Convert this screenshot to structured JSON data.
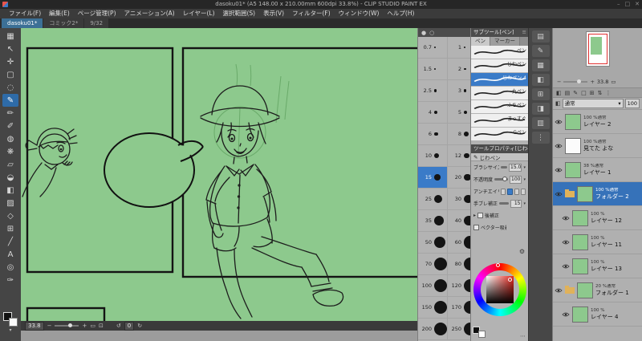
{
  "colors": {
    "accent": "#3a7bc8",
    "canvas_green": "#8dc98d",
    "selected_color": "#e8281e"
  },
  "window": {
    "title": "dasoku01* (A5 148.00 x 210.00mm 600dpi 33.8%) - CLIP STUDIO PAINT EX",
    "controls": {
      "minimize": "–",
      "maximize": "□",
      "close": "✕"
    }
  },
  "menu": {
    "items": [
      "ファイル(F)",
      "編集(E)",
      "ページ管理(P)",
      "アニメーション(A)",
      "レイヤー(L)",
      "選択範囲(S)",
      "表示(V)",
      "フィルター(F)",
      "ウィンドウ(W)",
      "ヘルプ(H)"
    ]
  },
  "tabs": [
    {
      "label": "dasoku01*",
      "active": true
    },
    {
      "label": "コミック2*",
      "active": false
    },
    {
      "label": "9/32",
      "active": false
    }
  ],
  "toolbar": {
    "tools": [
      {
        "id": "layout",
        "glyph": "▦"
      },
      {
        "id": "operation",
        "glyph": "↖"
      },
      {
        "id": "move",
        "glyph": "✛"
      },
      {
        "id": "selection",
        "glyph": "▢"
      },
      {
        "id": "auto-select",
        "glyph": "◌"
      },
      {
        "id": "pen",
        "glyph": "✎",
        "selected": true
      },
      {
        "id": "pencil",
        "glyph": "✏"
      },
      {
        "id": "brush",
        "glyph": "✐"
      },
      {
        "id": "airbrush",
        "glyph": "◍"
      },
      {
        "id": "decoration",
        "glyph": "❋"
      },
      {
        "id": "eraser",
        "glyph": "▱"
      },
      {
        "id": "blend",
        "glyph": "◒"
      },
      {
        "id": "fill",
        "glyph": "◧"
      },
      {
        "id": "gradient",
        "glyph": "▨"
      },
      {
        "id": "figure",
        "glyph": "◇"
      },
      {
        "id": "frame",
        "glyph": "⊞"
      },
      {
        "id": "ruler",
        "glyph": "╱"
      },
      {
        "id": "text",
        "glyph": "A"
      },
      {
        "id": "balloon",
        "glyph": "◎"
      },
      {
        "id": "correction",
        "glyph": "✑"
      }
    ]
  },
  "statusbar": {
    "zoom": "33.8",
    "rotation": "0"
  },
  "sizes_panel": {
    "cells": [
      {
        "v": "0.7"
      },
      {
        "v": "1"
      },
      {
        "v": "1.5"
      },
      {
        "v": "2"
      },
      {
        "v": "2.5"
      },
      {
        "v": "3"
      },
      {
        "v": "4"
      },
      {
        "v": "5"
      },
      {
        "v": "6"
      },
      {
        "v": "8"
      },
      {
        "v": "10"
      },
      {
        "v": "12"
      },
      {
        "v": "15",
        "selected": true
      },
      {
        "v": "20"
      },
      {
        "v": "25"
      },
      {
        "v": "30"
      },
      {
        "v": "35"
      },
      {
        "v": "40"
      },
      {
        "v": "50"
      },
      {
        "v": "60"
      },
      {
        "v": "70"
      },
      {
        "v": "80"
      },
      {
        "v": "100"
      },
      {
        "v": "120"
      },
      {
        "v": "150"
      },
      {
        "v": "170"
      },
      {
        "v": "200"
      },
      {
        "v": "250"
      }
    ]
  },
  "subtool": {
    "title": "サブツール[ペン]",
    "tabs": [
      {
        "label": "ペン",
        "active": true
      },
      {
        "label": "マーカー",
        "active": false
      }
    ],
    "items": [
      {
        "label": "ペン"
      },
      {
        "label": "じわペン"
      },
      {
        "label": "じわペン 4",
        "selected": true
      },
      {
        "label": "丸ペン"
      },
      {
        "label": "ふちペン"
      },
      {
        "label": "まっすぐ"
      },
      {
        "label": "Gペン"
      }
    ]
  },
  "tool_property": {
    "title": "ツールプロパティ[じわペン]",
    "tool_name": "じわペン",
    "brush_size": {
      "label": "ブラシサイズ",
      "value": "15.0"
    },
    "opacity": {
      "label": "不透明度",
      "value": "100"
    },
    "antialias": {
      "label": "アンチエイリアス"
    },
    "stabilize": {
      "label": "手ブレ補正",
      "value": "15"
    },
    "post_correct": {
      "label": "後補正"
    },
    "vector_snap": {
      "label": "ベクター吸着"
    }
  },
  "navigator": {
    "zoom": "33.8"
  },
  "layers": {
    "blend_mode": "通常",
    "opacity": "100",
    "items": [
      {
        "meta": "100 %通常",
        "name": "レイヤー 2"
      },
      {
        "meta": "100 %通常",
        "name": "見てた よな",
        "text_layer": true
      },
      {
        "meta": "38 %通常",
        "name": "レイヤー 1"
      },
      {
        "meta": "100 %通常",
        "name": "フォルダー 2",
        "folder": true,
        "selected": true
      },
      {
        "meta": "100 %",
        "name": "レイヤー 12",
        "indent": 1
      },
      {
        "meta": "100 %",
        "name": "レイヤー 11",
        "indent": 1
      },
      {
        "meta": "100 %",
        "name": "レイヤー 13",
        "indent": 1
      },
      {
        "meta": "20 %通常",
        "name": "フォルダー 1",
        "folder": true
      },
      {
        "meta": "100 %",
        "name": "レイヤー 4",
        "indent": 1
      }
    ]
  },
  "dock_icons": [
    "▤",
    "✎",
    "▦",
    "◧",
    "⊞",
    "◨",
    "▥",
    "⋮"
  ],
  "layer_toolbar_icons": [
    "◧",
    "▤",
    "✎",
    "□",
    "⊞",
    "⇅",
    "⋮"
  ]
}
